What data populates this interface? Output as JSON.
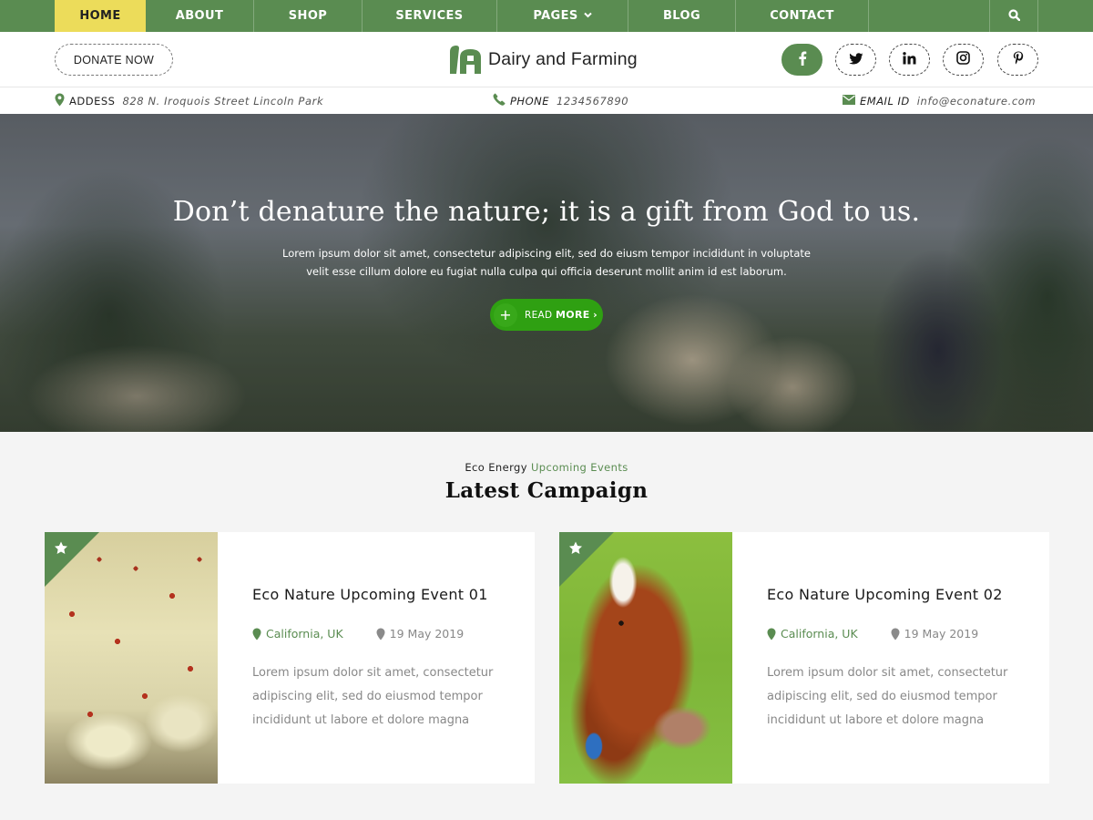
{
  "topnav": {
    "items": [
      {
        "label": "HOME",
        "active": true
      },
      {
        "label": "ABOUT"
      },
      {
        "label": "SHOP"
      },
      {
        "label": "SERVICES"
      },
      {
        "label": "PAGES",
        "has_dropdown": true
      },
      {
        "label": "BLOG"
      },
      {
        "label": "CONTACT"
      }
    ],
    "search_icon": "search-icon"
  },
  "header": {
    "donate_label": "DONATE NOW",
    "site_name": "Dairy and Farming",
    "logo_icon": "barn-logo-icon",
    "social": [
      {
        "icon": "facebook-icon",
        "active": true
      },
      {
        "icon": "twitter-icon"
      },
      {
        "icon": "linkedin-icon"
      },
      {
        "icon": "instagram-icon"
      },
      {
        "icon": "pinterest-icon"
      }
    ]
  },
  "infobar": {
    "address_label": "ADDESS",
    "address_value": "828 N. Iroquois Street Lincoln Park",
    "phone_label": "PHONE",
    "phone_value": "1234567890",
    "email_label": "EMAIL ID",
    "email_value": "info@econature.com"
  },
  "hero": {
    "headline": "Don’t denature the nature; it is a gift from God to us.",
    "body_line1": "Lorem ipsum dolor sit amet, consectetur adipiscing elit, sed do eiusm tempor incididunt in voluptate",
    "body_line2": "velit esse cillum dolore eu fugiat nulla culpa qui officia deserunt mollit anim id est laborum.",
    "button_light": "READ",
    "button_bold": "MORE",
    "button_arrow": "›",
    "button_plus": "+"
  },
  "campaign": {
    "subtitle_plain": "Eco Energy",
    "subtitle_accent": "Upcoming Events",
    "title": "Latest Campaign",
    "cards": [
      {
        "title": "Eco Nature Upcoming Event 01",
        "location": "California, UK",
        "date": "19 May 2019",
        "description": "Lorem ipsum dolor sit amet, consectetur adipiscing elit, sed do eiusmod tempor incididunt ut labore et dolore magna",
        "image": "chickens-photo"
      },
      {
        "title": "Eco Nature Upcoming Event 02",
        "location": "California, UK",
        "date": "19 May 2019",
        "description": "Lorem ipsum dolor sit amet, consectetur adipiscing elit, sed do eiusmod tempor incididunt ut labore et dolore magna",
        "image": "cow-photo"
      }
    ]
  },
  "colors": {
    "brand_green": "#5a8c51",
    "nav_active": "#ecdc5a",
    "cta_green": "#2fa012",
    "page_bg": "#f4f4f4"
  }
}
